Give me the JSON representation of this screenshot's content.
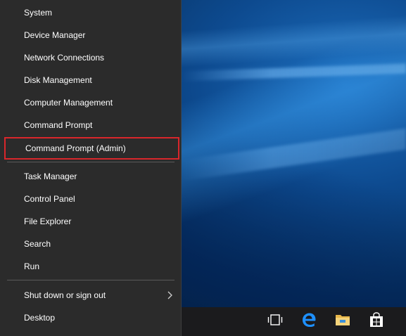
{
  "menu": {
    "items": [
      {
        "label": "System"
      },
      {
        "label": "Device Manager"
      },
      {
        "label": "Network Connections"
      },
      {
        "label": "Disk Management"
      },
      {
        "label": "Computer Management"
      },
      {
        "label": "Command Prompt"
      },
      {
        "label": "Command Prompt (Admin)",
        "highlighted": true
      },
      {
        "label": "Task Manager"
      },
      {
        "label": "Control Panel"
      },
      {
        "label": "File Explorer"
      },
      {
        "label": "Search"
      },
      {
        "label": "Run"
      },
      {
        "label": "Shut down or sign out",
        "submenu": true
      },
      {
        "label": "Desktop"
      }
    ],
    "highlight_color": "#d9262b"
  },
  "taskbar": {
    "icons": [
      "task-view-icon",
      "edge-icon",
      "file-explorer-icon",
      "store-icon"
    ]
  }
}
